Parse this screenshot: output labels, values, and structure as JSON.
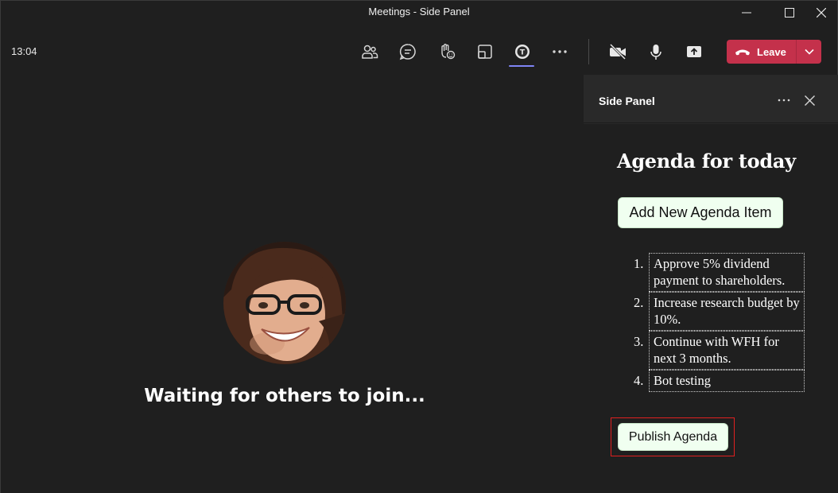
{
  "window": {
    "title": "Meetings - Side Panel",
    "minimize_icon": "minimize-icon",
    "maximize_icon": "maximize-icon",
    "close_icon": "close-icon"
  },
  "toolbar": {
    "clock": "13:04",
    "icons": [
      "people-icon",
      "chat-icon",
      "raise-hand-icon",
      "share-tray-icon",
      "app-icon",
      "more-icon",
      "camera-off-icon",
      "mic-icon",
      "share-screen-icon"
    ],
    "leave_label": "Leave",
    "leave_color": "#c4314b",
    "active_accent": "#7f85f5"
  },
  "stage": {
    "waiting_text": "Waiting for others to join..."
  },
  "side_panel": {
    "title": "Side Panel",
    "agenda_title": "Agenda for today",
    "add_button_label": "Add New Agenda Item",
    "items": [
      {
        "num": "1.",
        "text": "Approve 5% dividend payment to shareholders."
      },
      {
        "num": "2.",
        "text": "Increase research budget by 10%."
      },
      {
        "num": "3.",
        "text": "Continue with WFH for next 3 months."
      },
      {
        "num": "4.",
        "text": "Bot testing"
      }
    ],
    "publish_button_label": "Publish Agenda",
    "highlight_color": "#e02020"
  }
}
